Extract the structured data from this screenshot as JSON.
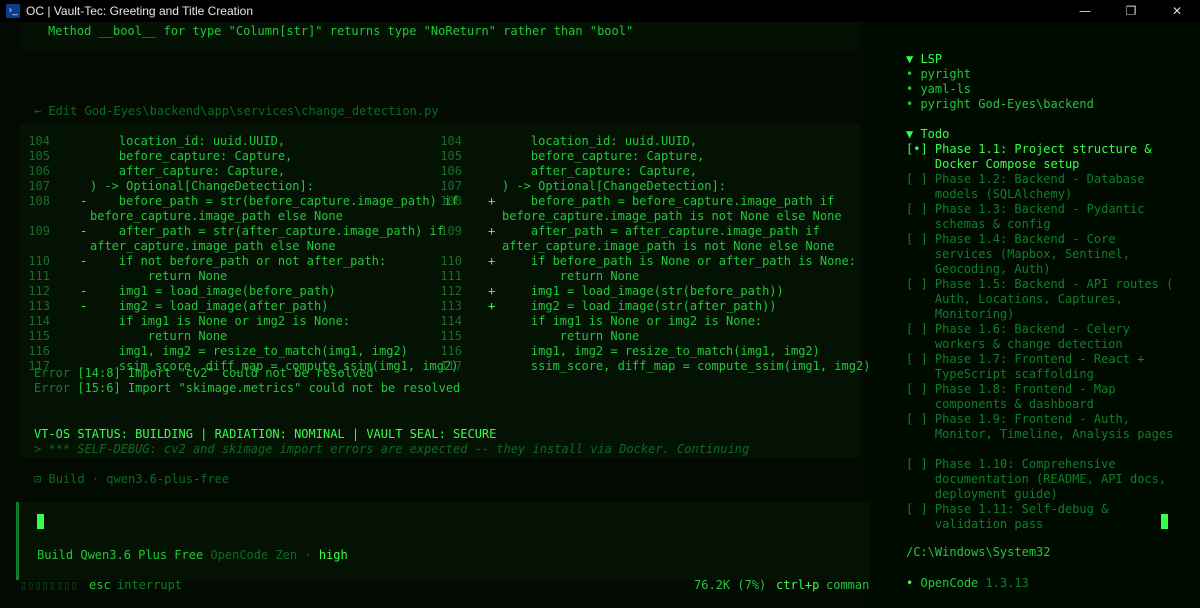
{
  "window": {
    "title": "OC | Vault-Tec: Greeting and Title Creation",
    "controls": {
      "minimize": "—",
      "maximize": "❐",
      "close": "✕"
    }
  },
  "top_message": "Method __bool__ for type \"Column[str]\" returns type \"NoReturn\" rather than \"bool\"",
  "edit_header": "← Edit God-Eyes\\backend\\app\\services\\change_detection.py",
  "diff": {
    "left": [
      {
        "ln": "104",
        "mk": "",
        "code": "    location_id: uuid.UUID,"
      },
      {
        "ln": "105",
        "mk": "",
        "code": "    before_capture: Capture,"
      },
      {
        "ln": "106",
        "mk": "",
        "code": "    after_capture: Capture,"
      },
      {
        "ln": "107",
        "mk": "",
        "code": ") -> Optional[ChangeDetection]:"
      },
      {
        "ln": "108",
        "mk": "-",
        "code": "    before_path = str(before_capture.image_path) if"
      },
      {
        "ln": "",
        "mk": "",
        "code": "before_capture.image_path else None"
      },
      {
        "ln": "109",
        "mk": "-",
        "code": "    after_path = str(after_capture.image_path) if"
      },
      {
        "ln": "",
        "mk": "",
        "code": "after_capture.image_path else None"
      },
      {
        "ln": "110",
        "mk": "-",
        "code": "    if not before_path or not after_path:"
      },
      {
        "ln": "111",
        "mk": "",
        "code": "        return None"
      },
      {
        "ln": "112",
        "mk": "-",
        "code": "    img1 = load_image(before_path)"
      },
      {
        "ln": "113",
        "mk": "-",
        "code": "    img2 = load_image(after_path)"
      },
      {
        "ln": "114",
        "mk": "",
        "code": "    if img1 is None or img2 is None:"
      },
      {
        "ln": "115",
        "mk": "",
        "code": "        return None"
      },
      {
        "ln": "116",
        "mk": "",
        "code": "    img1, img2 = resize_to_match(img1, img2)"
      },
      {
        "ln": "117",
        "mk": "",
        "code": "    ssim_score, diff_map = compute_ssim(img1, img2)"
      }
    ],
    "right": [
      {
        "ln": "104",
        "mk": "",
        "code": "    location_id: uuid.UUID,"
      },
      {
        "ln": "105",
        "mk": "",
        "code": "    before_capture: Capture,"
      },
      {
        "ln": "106",
        "mk": "",
        "code": "    after_capture: Capture,"
      },
      {
        "ln": "107",
        "mk": "",
        "code": ") -> Optional[ChangeDetection]:"
      },
      {
        "ln": "108",
        "mk": "+",
        "code": "    before_path = before_capture.image_path if"
      },
      {
        "ln": "",
        "mk": "",
        "code": "before_capture.image_path is not None else None"
      },
      {
        "ln": "109",
        "mk": "+",
        "code": "    after_path = after_capture.image_path if"
      },
      {
        "ln": "",
        "mk": "",
        "code": "after_capture.image_path is not None else None"
      },
      {
        "ln": "110",
        "mk": "+",
        "code": "    if before_path is None or after_path is None:"
      },
      {
        "ln": "111",
        "mk": "",
        "code": "        return None"
      },
      {
        "ln": "112",
        "mk": "+",
        "code": "    img1 = load_image(str(before_path))"
      },
      {
        "ln": "113",
        "mk": "+",
        "code": "    img2 = load_image(str(after_path))"
      },
      {
        "ln": "114",
        "mk": "",
        "code": "    if img1 is None or img2 is None:"
      },
      {
        "ln": "115",
        "mk": "",
        "code": "        return None"
      },
      {
        "ln": "116",
        "mk": "",
        "code": "    img1, img2 = resize_to_match(img1, img2)"
      },
      {
        "ln": "117",
        "mk": "",
        "code": "    ssim_score, diff_map = compute_ssim(img1, img2)"
      }
    ]
  },
  "errors": [
    {
      "label": "Error",
      "loc": "[14:8]",
      "msg": "Import \"cv2\" could not be resolved"
    },
    {
      "label": "Error",
      "loc": "[15:6]",
      "msg": "Import \"skimage.metrics\" could not be resolved"
    }
  ],
  "status_line": "VT-OS STATUS: BUILDING | RADIATION: NOMINAL | VAULT SEAL: SECURE",
  "self_debug": ">  *** SELF-DEBUG: cv2 and skimage import errors are expected -- they install via Docker. Continuing",
  "build_line": {
    "icon": "⊡",
    "label": "Build",
    "sep": "·",
    "model": "qwen3.6-plus-free"
  },
  "input_build": {
    "mode": "Build",
    "model": "Qwen3.6 Plus Free",
    "provider": "OpenCode Zen",
    "sep": "·",
    "variant": "high"
  },
  "footer": {
    "spinner": "▯▯▯▯▯▯▯▯",
    "interrupt_key": "esc",
    "interrupt_label": "interrupt",
    "tokens": "76.2K (7%)",
    "commands_key": "ctrl+p",
    "commands_label": "commands"
  },
  "sidebar": {
    "lsp_title": "▼ LSP",
    "lsp_items": [
      "• pyright",
      "• yaml-ls",
      "• pyright God-Eyes\\backend"
    ],
    "todo_title": "▼ Todo",
    "todos": [
      {
        "box": "[•]",
        "text": "Phase 1.1: Project structure &\n    Docker Compose setup",
        "state": "active"
      },
      {
        "box": "[ ]",
        "text": "Phase 1.2: Backend - Database\n    models (SQLAlchemy)",
        "state": "pending"
      },
      {
        "box": "[ ]",
        "text": "Phase 1.3: Backend - Pydantic\n    schemas & config",
        "state": "pending"
      },
      {
        "box": "[ ]",
        "text": "Phase 1.4: Backend - Core\n    services (Mapbox, Sentinel,\n    Geocoding, Auth)",
        "state": "pending"
      },
      {
        "box": "[ ]",
        "text": "Phase 1.5: Backend - API routes (\n    Auth, Locations, Captures,\n    Monitoring)",
        "state": "pending"
      },
      {
        "box": "[ ]",
        "text": "Phase 1.6: Backend - Celery\n    workers & change detection",
        "state": "pending"
      },
      {
        "box": "[ ]",
        "text": "Phase 1.7: Frontend - React +\n    TypeScript scaffolding",
        "state": "pending"
      },
      {
        "box": "[ ]",
        "text": "Phase 1.8: Frontend - Map\n    components & dashboard",
        "state": "pending"
      },
      {
        "box": "[ ]",
        "text": "Phase 1.9: Frontend - Auth,\n    Monitor, Timeline, Analysis pages",
        "state": "pending"
      },
      {
        "box": "[ ]",
        "text": "Phase 1.10: Comprehensive\n    documentation (README, API docs,\n    deployment guide)",
        "state": "pending"
      },
      {
        "box": "[ ]",
        "text": "Phase 1.11: Self-debug &\n    validation pass",
        "state": "pending"
      }
    ],
    "cwd": "/C:\\Windows\\System32",
    "app_name_bullet": "•",
    "app_name": "OpenCode",
    "app_version": "1.3.13"
  }
}
